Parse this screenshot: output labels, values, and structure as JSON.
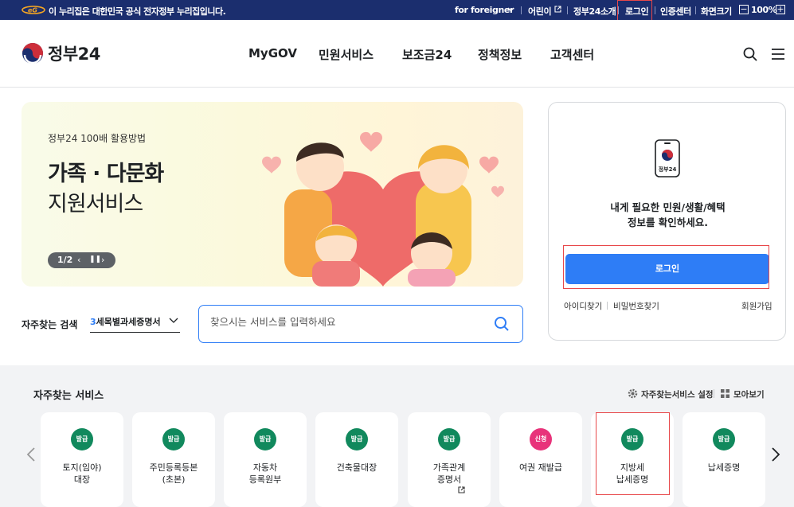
{
  "topbar": {
    "notice": "이 누리집은 대한민국 공식 전자정부 누리집입니다.",
    "foreigner": "for foreigner",
    "kids": "어린이",
    "intro": "정부24소개",
    "login": "로그인",
    "cert": "인증센터",
    "screen_size": "화면크기",
    "zoom_minus": "−",
    "zoom": "100%",
    "zoom_plus": "+"
  },
  "header": {
    "logo": "정부24",
    "nav": [
      "MyGOV",
      "민원서비스",
      "보조금24",
      "정책정보",
      "고객센터"
    ]
  },
  "hero": {
    "subtitle": "정부24 100배 활용방법",
    "title_line1": "가족 · 다문화",
    "title_line2": "지원서비스",
    "pager": "1/2"
  },
  "login_panel": {
    "phone_label": "정부24",
    "message_line1": "내게 필요한 민원/생활/혜택",
    "message_line2": "정보를 확인하세요.",
    "login_button": "로그인",
    "find_id": "아이디찾기",
    "find_pw": "비밀번호찾기",
    "signup": "회원가입"
  },
  "search": {
    "label": "자주찾는 검색",
    "select_num": "3",
    "select_text": "세목별과세증명서",
    "placeholder": "찾으시는 서비스를 입력하세요"
  },
  "services": {
    "title": "자주찾는 서비스",
    "settings": "자주찾는서비스 설정",
    "view_all": "모아보기",
    "cards": [
      {
        "badge": "발급",
        "label": "토지(임야)\n대장"
      },
      {
        "badge": "발급",
        "label": "주민등록등본\n(초본)"
      },
      {
        "badge": "발급",
        "label": "자동차\n등록원부"
      },
      {
        "badge": "발급",
        "label": "건축물대장"
      },
      {
        "badge": "발급",
        "label": "가족관계\n증명서"
      },
      {
        "badge": "신청",
        "label": "여권 재발급"
      },
      {
        "badge": "발급",
        "label": "지방세\n납세증명"
      },
      {
        "badge": "발급",
        "label": "납세증명"
      }
    ]
  },
  "colors": {
    "topbar_bg": "#1b2e6e",
    "primary": "#2e7df6",
    "badge_issue": "#11895d",
    "badge_apply": "#e8337a",
    "highlight": "#e8484a"
  }
}
